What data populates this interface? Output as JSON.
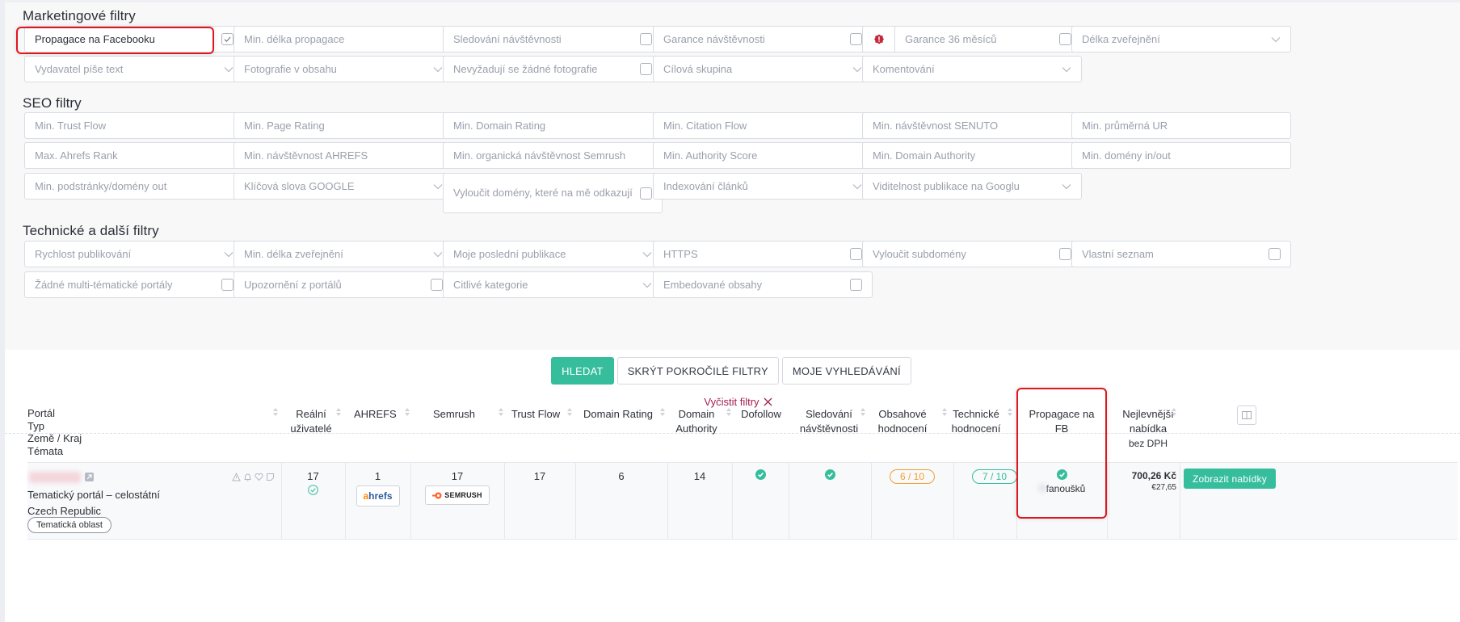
{
  "sections": {
    "marketing": "Marketingové filtry",
    "seo": "SEO filtry",
    "technical": "Technické a další filtry"
  },
  "marketing_filters": [
    {
      "label": "Propagace na Facebooku",
      "type": "checkbox",
      "checked": true
    },
    {
      "label": "Min. délka propagace",
      "type": "input"
    },
    {
      "label": "Sledování návštěvnosti",
      "type": "checkbox",
      "checked": false
    },
    {
      "label": "Garance návštěvnosti",
      "type": "checkbox",
      "checked": false
    },
    {
      "label": "Garance 36 měsíců",
      "type": "checkbox",
      "checked": false,
      "icon": "alert-badge-icon"
    },
    {
      "label": "Délka zveřejnění",
      "type": "select"
    },
    {
      "label": "Vydavatel píše text",
      "type": "select"
    },
    {
      "label": "Fotografie v obsahu",
      "type": "select"
    },
    {
      "label": "Nevyžadují se žádné fotografie",
      "type": "checkbox",
      "checked": false
    },
    {
      "label": "Cílová skupina",
      "type": "select"
    },
    {
      "label": "Komentování",
      "type": "select"
    }
  ],
  "seo_filters": [
    {
      "label": "Min. Trust Flow",
      "type": "input"
    },
    {
      "label": "Min. Page Rating",
      "type": "input"
    },
    {
      "label": "Min. Domain Rating",
      "type": "input"
    },
    {
      "label": "Min. Citation Flow",
      "type": "input"
    },
    {
      "label": "Min. návštěvnost SENUTO",
      "type": "input"
    },
    {
      "label": "Min. průměrná UR",
      "type": "input"
    },
    {
      "label": "Max. Ahrefs Rank",
      "type": "input"
    },
    {
      "label": "Min. návštěvnost AHREFS",
      "type": "input"
    },
    {
      "label": "Min. organická návštěvnost Semrush",
      "type": "input"
    },
    {
      "label": "Min. Authority Score",
      "type": "input"
    },
    {
      "label": "Min. Domain Authority",
      "type": "input"
    },
    {
      "label": "Min. domény in/out",
      "type": "input"
    },
    {
      "label": "Min. podstránky/domény out",
      "type": "input"
    },
    {
      "label": "Klíčová slova GOOGLE",
      "type": "select"
    },
    {
      "label": "Vyloučit domény, které na mě odkazují",
      "type": "checkbox",
      "checked": false
    },
    {
      "label": "Indexování článků",
      "type": "select"
    },
    {
      "label": "Viditelnost publikace na Googlu",
      "type": "select"
    }
  ],
  "technical_filters": [
    {
      "label": "Rychlost publikování",
      "type": "select"
    },
    {
      "label": "Min. délka zveřejnění",
      "type": "select"
    },
    {
      "label": "Moje poslední publikace",
      "type": "select"
    },
    {
      "label": "HTTPS",
      "type": "checkbox",
      "checked": false
    },
    {
      "label": "Vyloučit subdomény",
      "type": "checkbox",
      "checked": false
    },
    {
      "label": "Vlastní seznam",
      "type": "checkbox",
      "checked": false
    },
    {
      "label": "Žádné multi-tématické portály",
      "type": "checkbox",
      "checked": false
    },
    {
      "label": "Upozornění z portálů",
      "type": "checkbox",
      "checked": false
    },
    {
      "label": "Citlivé kategorie",
      "type": "select"
    },
    {
      "label": "Embedované obsahy",
      "type": "checkbox",
      "checked": false
    }
  ],
  "actions": {
    "search": "HLEDAT",
    "hide_advanced": "SKRÝT POKROČILÉ FILTRY",
    "my_searches": "MOJE VYHLEDÁVÁNÍ",
    "clear_filters": "Vyčistit filtry"
  },
  "table": {
    "headers": {
      "portal": [
        "Portál",
        "Typ",
        "Země / Kraj",
        "Témata"
      ],
      "real_users": [
        "Reální",
        "uživatelé"
      ],
      "ahrefs": [
        "AHREFS"
      ],
      "semrush": [
        "Semrush"
      ],
      "trust_flow": [
        "Trust Flow"
      ],
      "domain_rating": [
        "Domain Rating"
      ],
      "domain_authority": [
        "Domain",
        "Authority"
      ],
      "dofollow": [
        "Dofollow"
      ],
      "traffic_tracking": [
        "Sledování",
        "návštěvnosti"
      ],
      "content_rating": [
        "Obsahové",
        "hodnocení"
      ],
      "technical_rating": [
        "Technické",
        "hodnocení"
      ],
      "fb_promo": [
        "Propagace na FB"
      ],
      "cheapest_offer": [
        "Nejlevnější",
        "nabídka",
        "bez DPH"
      ]
    },
    "rows": [
      {
        "portal_type": "Tematický portál – celostátní",
        "country": "Czech Republic",
        "topic_tag": "Tematická oblast",
        "real_users": "17",
        "real_users_verified": true,
        "ahrefs": "1",
        "ahrefs_logo": "ahrefs",
        "semrush": "17",
        "semrush_logo": "SEMRUSH",
        "trust_flow": "17",
        "domain_rating": "6",
        "domain_authority": "14",
        "dofollow": true,
        "traffic_tracking": true,
        "content_rating": "6 / 10",
        "technical_rating": "7 / 10",
        "fb_promo": true,
        "fb_fans_suffix": "fanoušků",
        "price_czk": "700,26 Kč",
        "price_eur": "€27,65",
        "show_offers": "Zobrazit nabídky"
      }
    ]
  },
  "colors": {
    "accent": "#35bd9c",
    "highlight": "#e0171f",
    "clear_link": "#a3204f",
    "badge_orange": "#f0a030",
    "badge_teal": "#35bd9c"
  }
}
